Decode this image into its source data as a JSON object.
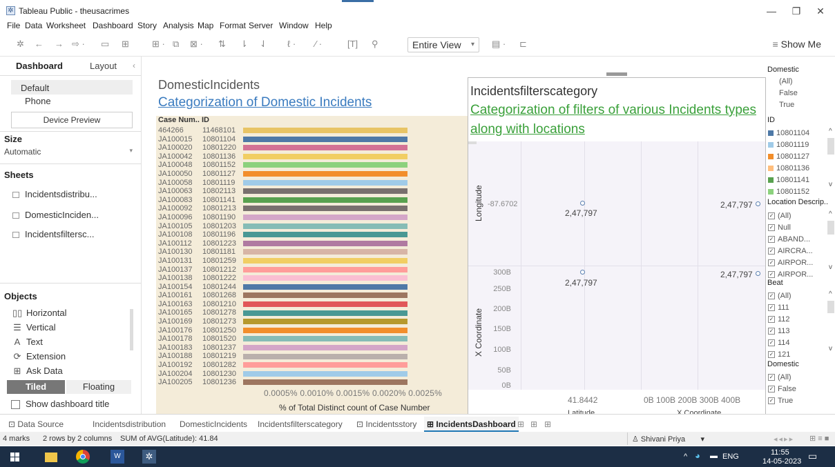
{
  "window": {
    "title": "Tableau Public - theusacrimes"
  },
  "menu": [
    "File",
    "Data",
    "Worksheet",
    "Dashboard",
    "Story",
    "Analysis",
    "Map",
    "Format",
    "Server",
    "Window",
    "Help"
  ],
  "toolbar": {
    "fit_value": "Entire View",
    "show_me": "Show Me"
  },
  "left_panel": {
    "tabs": [
      "Dashboard",
      "Layout"
    ],
    "device": {
      "selected": "Default",
      "other": "Phone",
      "preview_button": "Device Preview"
    },
    "size": {
      "heading": "Size",
      "value": "Automatic"
    },
    "sheets": {
      "heading": "Sheets",
      "items": [
        "Incidentsdistribu...",
        "DomesticInciden...",
        "Incidentsfiltersc..."
      ]
    },
    "objects": {
      "heading": "Objects",
      "items": [
        "Horizontal",
        "Vertical",
        "Text",
        "Extension",
        "Ask Data"
      ]
    },
    "tiled": "Tiled",
    "floating": "Floating",
    "show_title": "Show dashboard title"
  },
  "sheet1": {
    "title": "DomesticIncidents",
    "subtitle": "Categorization of Domestic Incidents",
    "col_headers": [
      "Case Num..",
      "ID"
    ],
    "axis_title": "% of Total Distinct count of Case Number",
    "axis_ticks": [
      "0.0005%",
      "0.0010%",
      "0.0015%",
      "0.0020%",
      "0.0025%"
    ]
  },
  "chart_data": {
    "type": "bar",
    "categories": [
      "464266 11468101",
      "JA100015 10801104",
      "JA100020 10801220",
      "JA100042 10801136",
      "JA100048 10801152",
      "JA100050 10801127",
      "JA100058 10801119",
      "JA100063 10802113",
      "JA100083 10801141",
      "JA100092 10801213",
      "JA100096 10801190",
      "JA100105 10801203",
      "JA100108 10801196",
      "JA100112 10801223",
      "JA100130 10801181",
      "JA100131 10801259",
      "JA100137 10801212",
      "JA100138 10801222",
      "JA100154 10801244",
      "JA100161 10801268",
      "JA100163 10801210",
      "JA100165 10801278",
      "JA100169 10801273",
      "JA100176 10801250",
      "JA100178 10801520",
      "JA100183 10801237",
      "JA100188 10801219",
      "JA100192 10801282",
      "JA100204 10801230",
      "JA100205 10801236"
    ],
    "rows": [
      [
        "464266",
        "11468101"
      ],
      [
        "JA100015",
        "10801104"
      ],
      [
        "JA100020",
        "10801220"
      ],
      [
        "JA100042",
        "10801136"
      ],
      [
        "JA100048",
        "10801152"
      ],
      [
        "JA100050",
        "10801127"
      ],
      [
        "JA100058",
        "10801119"
      ],
      [
        "JA100063",
        "10802113"
      ],
      [
        "JA100083",
        "10801141"
      ],
      [
        "JA100092",
        "10801213"
      ],
      [
        "JA100096",
        "10801190"
      ],
      [
        "JA100105",
        "10801203"
      ],
      [
        "JA100108",
        "10801196"
      ],
      [
        "JA100112",
        "10801223"
      ],
      [
        "JA100130",
        "10801181"
      ],
      [
        "JA100131",
        "10801259"
      ],
      [
        "JA100137",
        "10801212"
      ],
      [
        "JA100138",
        "10801222"
      ],
      [
        "JA100154",
        "10801244"
      ],
      [
        "JA100161",
        "10801268"
      ],
      [
        "JA100163",
        "10801210"
      ],
      [
        "JA100165",
        "10801278"
      ],
      [
        "JA100169",
        "10801273"
      ],
      [
        "JA100176",
        "10801250"
      ],
      [
        "JA100178",
        "10801520"
      ],
      [
        "JA100183",
        "10801237"
      ],
      [
        "JA100188",
        "10801219"
      ],
      [
        "JA100192",
        "10801282"
      ],
      [
        "JA100204",
        "10801230"
      ],
      [
        "JA100205",
        "10801236"
      ]
    ],
    "values": [
      0.0024,
      0.0024,
      0.0024,
      0.0024,
      0.0024,
      0.0024,
      0.0024,
      0.0024,
      0.0024,
      0.0024,
      0.0024,
      0.0024,
      0.0024,
      0.0024,
      0.0024,
      0.0024,
      0.0024,
      0.0024,
      0.0024,
      0.0024,
      0.0024,
      0.0024,
      0.0024,
      0.0024,
      0.0024,
      0.0024,
      0.0024,
      0.0024,
      0.0024,
      0.0024
    ],
    "colors": [
      "#e8c465",
      "#4e79a7",
      "#d37295",
      "#f1ce63",
      "#8cd17d",
      "#f28e2b",
      "#a0cbe8",
      "#79706e",
      "#59a14f",
      "#79706e",
      "#d4a6c8",
      "#86bcb6",
      "#499894",
      "#b07aa1",
      "#d7b5a6",
      "#f1ce63",
      "#ff9d9a",
      "#fabfd2",
      "#4e79a7",
      "#9d7660",
      "#e15759",
      "#499894",
      "#b6992d",
      "#f28e2b",
      "#86bcb6",
      "#d4a6c8",
      "#bab0ac",
      "#ff9d9a",
      "#a0cbe8",
      "#9d7660"
    ],
    "xlim": [
      0,
      0.0027
    ],
    "xlabel": "% of Total Distinct count of Case Number"
  },
  "sheet2": {
    "title": "Incidentsfilterscategory",
    "subtitle": "Categorization of filters of various Incidents types along with locations",
    "y1_label": "Longitude",
    "y1_tick": "-87.6702",
    "y2_label": "X Coordinate",
    "y2_ticks": [
      "300B",
      "250B",
      "200B",
      "150B",
      "100B",
      "50B",
      "0B"
    ],
    "point_label": "2,47,797",
    "x_tick": "41.8442",
    "x2_ticks": "0B 100B 200B 300B 400B",
    "x_label_partial": "Latitude",
    "x2_label_partial": "X Coordinate"
  },
  "filters": {
    "domestic": {
      "title": "Domestic",
      "items": [
        "(All)",
        "False",
        "True"
      ]
    },
    "id": {
      "title": "ID",
      "items": [
        "10801104",
        "10801119",
        "10801127",
        "10801136",
        "10801141",
        "10801152"
      ],
      "colors": [
        "#4e79a7",
        "#a0cbe8",
        "#f28e2b",
        "#ffbe7d",
        "#59a14f",
        "#8cd17d"
      ]
    },
    "location": {
      "title": "Location Descrip..",
      "items": [
        "(All)",
        "Null",
        "ABAND...",
        "AIRCRA...",
        "AIRPOR...",
        "AIRPOR..."
      ]
    },
    "beat": {
      "title": "Beat",
      "items": [
        "(All)",
        "111",
        "112",
        "113",
        "114",
        "121"
      ]
    },
    "domestic2": {
      "title": "Domestic",
      "items": [
        "(All)",
        "False",
        "True"
      ]
    }
  },
  "tabs": {
    "data_source": "Data Source",
    "sheets": [
      "Incidentsdistribution",
      "DomesticIncidents",
      "Incidentsfilterscategory",
      "Incidentsstory",
      "IncidentsDashboard"
    ]
  },
  "status": {
    "marks": "4 marks",
    "grid": "2 rows by 2 columns",
    "sum": "SUM of AVG(Latitude): 41.84",
    "user": "Shivani Priya"
  },
  "taskbar": {
    "lang": "ENG",
    "time": "11:55",
    "date": "14-05-2023"
  }
}
